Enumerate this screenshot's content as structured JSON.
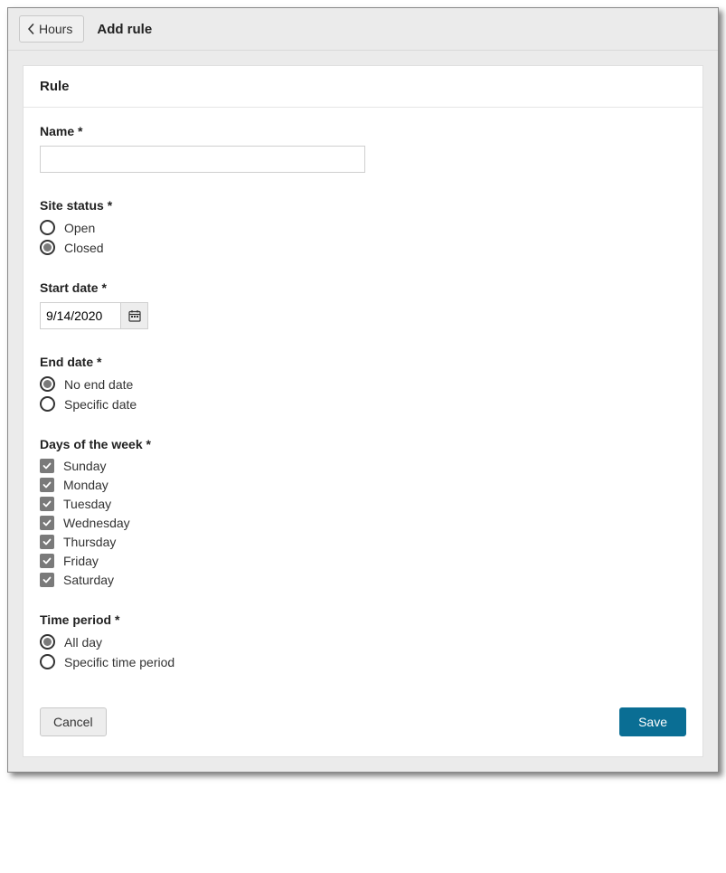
{
  "topbar": {
    "back_label": "Hours",
    "title": "Add rule"
  },
  "panel": {
    "header": "Rule"
  },
  "fields": {
    "name": {
      "label": "Name *",
      "value": ""
    },
    "site_status": {
      "label": "Site status *",
      "options": {
        "open": "Open",
        "closed": "Closed"
      },
      "selected": "closed"
    },
    "start_date": {
      "label": "Start date *",
      "value": "9/14/2020"
    },
    "end_date": {
      "label": "End date *",
      "options": {
        "no_end": "No end date",
        "specific": "Specific date"
      },
      "selected": "no_end"
    },
    "days": {
      "label": "Days of the week *",
      "items": {
        "sun": "Sunday",
        "mon": "Monday",
        "tue": "Tuesday",
        "wed": "Wednesday",
        "thu": "Thursday",
        "fri": "Friday",
        "sat": "Saturday"
      }
    },
    "time_period": {
      "label": "Time period *",
      "options": {
        "all_day": "All day",
        "specific": "Specific time period"
      },
      "selected": "all_day"
    }
  },
  "footer": {
    "cancel": "Cancel",
    "save": "Save"
  }
}
